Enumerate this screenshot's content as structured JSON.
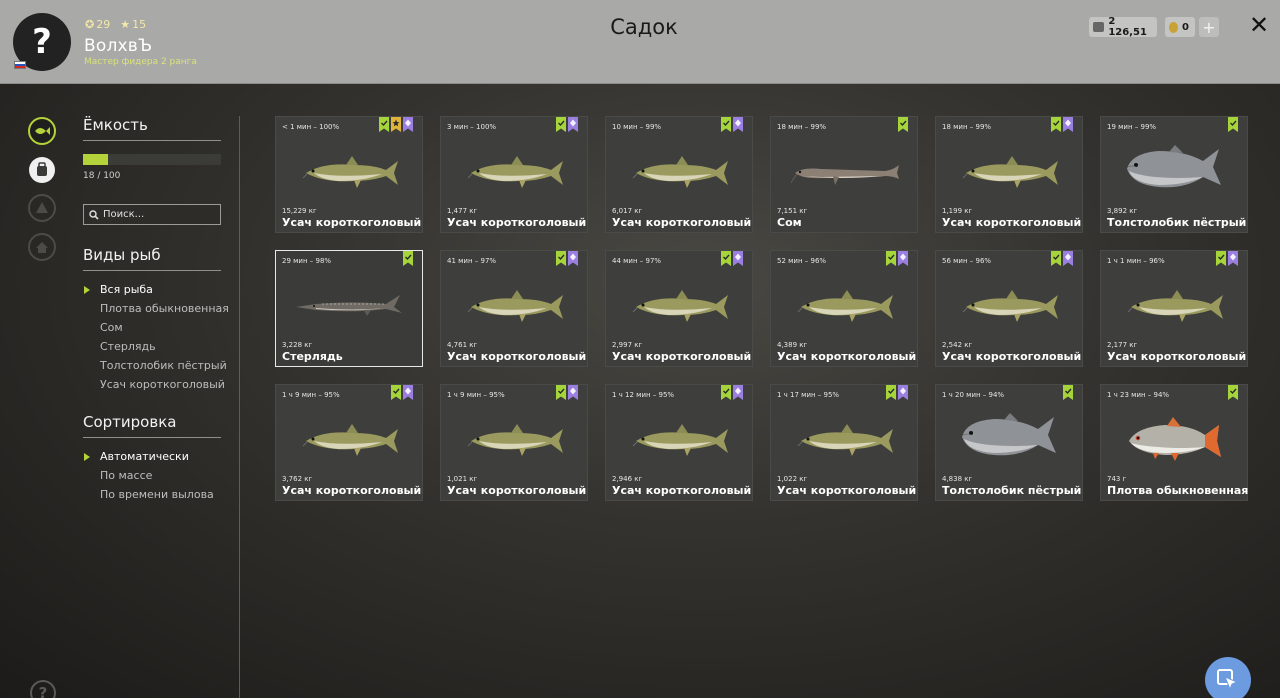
{
  "header": {
    "avatar_glyph": "?",
    "level": "29",
    "stars": "15",
    "username": "ВолхвЪ",
    "rank": "Мастер фидера 2 ранга",
    "title": "Садок",
    "silver": "2 126,51",
    "gold": "0",
    "plus": "+",
    "close": "✕"
  },
  "capacity": {
    "title": "Ёмкость",
    "used": 18,
    "total": 100,
    "fill_fraction": 0.18,
    "text": "18 / 100"
  },
  "search": {
    "placeholder": "Поиск..."
  },
  "species": {
    "title": "Виды рыб",
    "items": [
      "Вся рыба",
      "Плотва обыкновенная",
      "Сом",
      "Стерлядь",
      "Толстолобик пёстрый",
      "Усач короткоголовый"
    ],
    "selected": "Вся рыба"
  },
  "sorting": {
    "title": "Сортировка",
    "items": [
      "Автоматически",
      "По массе",
      "По времени вылова"
    ],
    "selected": "Автоматически"
  },
  "help_glyph": "?",
  "colors": {
    "accent": "#b4d23a",
    "badge_green": "#a6d53b",
    "badge_purple": "#9a7fe0",
    "badge_gold": "#e0b43a"
  },
  "fish": [
    {
      "time": "< 1 мин – 100%",
      "weight": "15,229 кг",
      "name": "Усач короткоголовый",
      "kind": "barbel",
      "badges": [
        "green",
        "gold",
        "purple"
      ]
    },
    {
      "time": "3 мин – 100%",
      "weight": "1,477 кг",
      "name": "Усач короткоголовый",
      "kind": "barbel",
      "badges": [
        "green",
        "purple"
      ]
    },
    {
      "time": "10 мин – 99%",
      "weight": "6,017 кг",
      "name": "Усач короткоголовый",
      "kind": "barbel",
      "badges": [
        "green",
        "purple"
      ]
    },
    {
      "time": "18 мин – 99%",
      "weight": "7,151 кг",
      "name": "Сом",
      "kind": "catfish",
      "badges": [
        "green"
      ]
    },
    {
      "time": "18 мин – 99%",
      "weight": "1,199 кг",
      "name": "Усач короткоголовый",
      "kind": "barbel",
      "badges": [
        "green",
        "purple"
      ]
    },
    {
      "time": "19 мин – 99%",
      "weight": "3,892 кг",
      "name": "Толстолобик пёстрый",
      "kind": "carp",
      "badges": [
        "green"
      ]
    },
    {
      "time": "29 мин – 98%",
      "weight": "3,228 кг",
      "name": "Стерлядь",
      "kind": "sterlet",
      "badges": [
        "green"
      ],
      "selected": true
    },
    {
      "time": "41 мин – 97%",
      "weight": "4,761 кг",
      "name": "Усач короткоголовый",
      "kind": "barbel",
      "badges": [
        "green",
        "purple"
      ]
    },
    {
      "time": "44 мин – 97%",
      "weight": "2,997 кг",
      "name": "Усач короткоголовый",
      "kind": "barbel",
      "badges": [
        "green",
        "purple"
      ]
    },
    {
      "time": "52 мин – 96%",
      "weight": "4,389 кг",
      "name": "Усач короткоголовый",
      "kind": "barbel",
      "badges": [
        "green",
        "purple"
      ]
    },
    {
      "time": "56 мин – 96%",
      "weight": "2,542 кг",
      "name": "Усач короткоголовый",
      "kind": "barbel",
      "badges": [
        "green",
        "purple"
      ]
    },
    {
      "time": "1 ч 1 мин – 96%",
      "weight": "2,177 кг",
      "name": "Усач короткоголовый",
      "kind": "barbel",
      "badges": [
        "green",
        "purple"
      ]
    },
    {
      "time": "1 ч 9 мин – 95%",
      "weight": "3,762 кг",
      "name": "Усач короткоголовый",
      "kind": "barbel",
      "badges": [
        "green",
        "purple"
      ]
    },
    {
      "time": "1 ч 9 мин – 95%",
      "weight": "1,021 кг",
      "name": "Усач короткоголовый",
      "kind": "barbel",
      "badges": [
        "green",
        "purple"
      ]
    },
    {
      "time": "1 ч 12 мин – 95%",
      "weight": "2,946 кг",
      "name": "Усач короткоголовый",
      "kind": "barbel",
      "badges": [
        "green",
        "purple"
      ]
    },
    {
      "time": "1 ч 17 мин – 95%",
      "weight": "1,022 кг",
      "name": "Усач короткоголовый",
      "kind": "barbel",
      "badges": [
        "green",
        "purple"
      ]
    },
    {
      "time": "1 ч 20 мин – 94%",
      "weight": "4,838 кг",
      "name": "Толстолобик пёстрый",
      "kind": "carp",
      "badges": [
        "green"
      ]
    },
    {
      "time": "1 ч 23 мин – 94%",
      "weight": "743 г",
      "name": "Плотва обыкновенная",
      "kind": "roach",
      "badges": [
        "green"
      ]
    }
  ]
}
